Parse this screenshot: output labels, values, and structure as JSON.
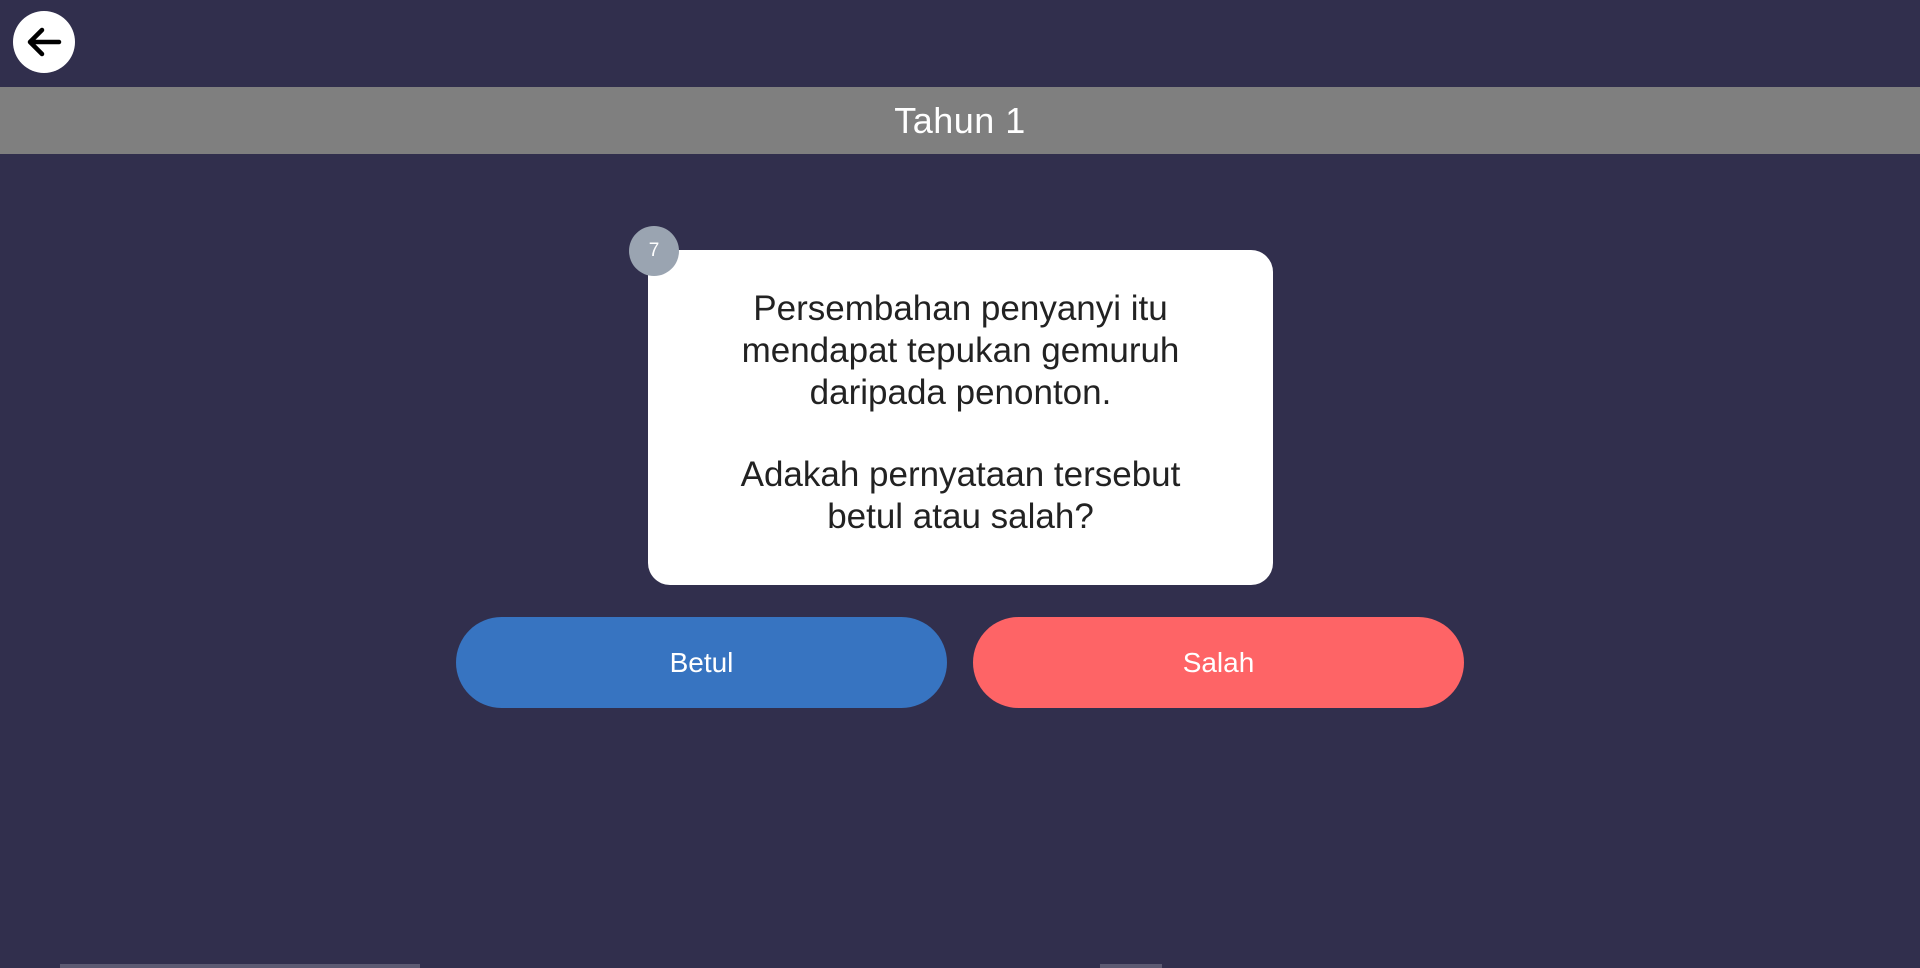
{
  "header": {
    "back_icon": "arrow-left-icon",
    "title": "Tahun 1"
  },
  "question": {
    "number": "7",
    "statement_lines": [
      "Persembahan penyanyi itu",
      "mendapat tepukan gemuruh",
      "daripada penonton."
    ],
    "prompt_lines": [
      "Adakah pernyataan tersebut",
      "betul atau salah?"
    ]
  },
  "answers": {
    "true_label": "Betul",
    "false_label": "Salah"
  },
  "colors": {
    "background": "#312f4d",
    "title_bar": "#7f7f7f",
    "true_button": "#3774c1",
    "false_button": "#fe6466",
    "number_badge": "#9aa4b1"
  }
}
